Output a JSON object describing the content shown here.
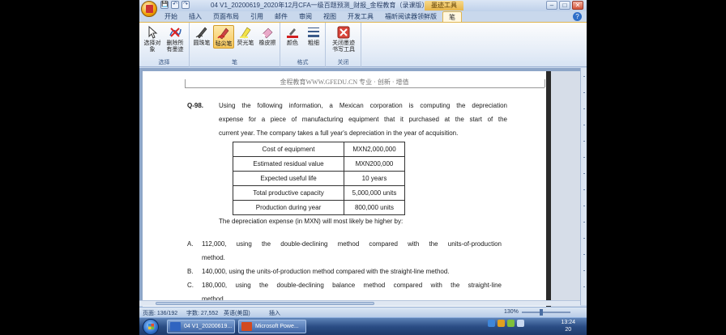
{
  "window": {
    "title": "04 V1_20200619_2020年12月CFA一级百题预测_财报_金程教育（录课版） - Micros...",
    "context_tab": "墨迹工具"
  },
  "quick_access": [
    "💾",
    "↶",
    "↷"
  ],
  "tabs": [
    {
      "label": "开始",
      "active": false
    },
    {
      "label": "插入",
      "active": false
    },
    {
      "label": "页面布局",
      "active": false
    },
    {
      "label": "引用",
      "active": false
    },
    {
      "label": "邮件",
      "active": false
    },
    {
      "label": "审阅",
      "active": false
    },
    {
      "label": "视图",
      "active": false
    },
    {
      "label": "开发工具",
      "active": false
    },
    {
      "label": "福昕阅读器领鲜版",
      "active": false
    },
    {
      "label": "笔",
      "active": true
    }
  ],
  "ribbon": {
    "groups": [
      {
        "label": "选择",
        "buttons": [
          "选择对象",
          "删除所有墨迹"
        ]
      },
      {
        "label": "笔",
        "buttons": [
          "圆珠笔",
          "毡尖笔",
          "荧光笔",
          "橡皮擦"
        ]
      },
      {
        "label": "格式",
        "buttons": [
          "颜色",
          "粗细"
        ]
      },
      {
        "label": "关闭",
        "buttons": [
          "关闭墨迹书写工具"
        ]
      }
    ]
  },
  "document": {
    "header": "金程教育WWW.GFEDU.CN 专业 · 创新 · 增值",
    "question_number": "Q-98.",
    "intro_lines": [
      "Using the following information, a Mexican corporation is computing the depreciation",
      "expense for a piece of manufacturing equipment that it purchased at the start of the",
      "current year. The company takes a full year's depreciation in the year of acquisition."
    ],
    "table": [
      {
        "label": "Cost of equipment",
        "value": "MXN2,000,000"
      },
      {
        "label": "Estimated residual value",
        "value": "MXN200,000"
      },
      {
        "label": "Expected useful life",
        "value": "10 years"
      },
      {
        "label": "Total productive capacity",
        "value": "5,000,000 units"
      },
      {
        "label": "Production during year",
        "value": "800,000 units"
      }
    ],
    "question": "The depreciation expense (in MXN) will most likely be higher by:",
    "options": [
      {
        "letter": "A.",
        "line1": "112,000, using the double-declining method compared with the units-of-production",
        "line2": "method."
      },
      {
        "letter": "B.",
        "line1": "140,000, using the units-of-production method compared with the straight-line method.",
        "line2": ""
      },
      {
        "letter": "C.",
        "line1": "180,000, using the double-declining balance method compared with the straight-line",
        "line2": "method."
      }
    ]
  },
  "status": {
    "page": "页面: 136/192",
    "words": "字数: 27,552",
    "language": "英语(美国)",
    "mode": "插入",
    "zoom": "130%"
  },
  "taskbar": {
    "tasks": [
      "04 V1_20200619...",
      "Microsoft Powe..."
    ],
    "time": "13:24",
    "date": "20"
  }
}
